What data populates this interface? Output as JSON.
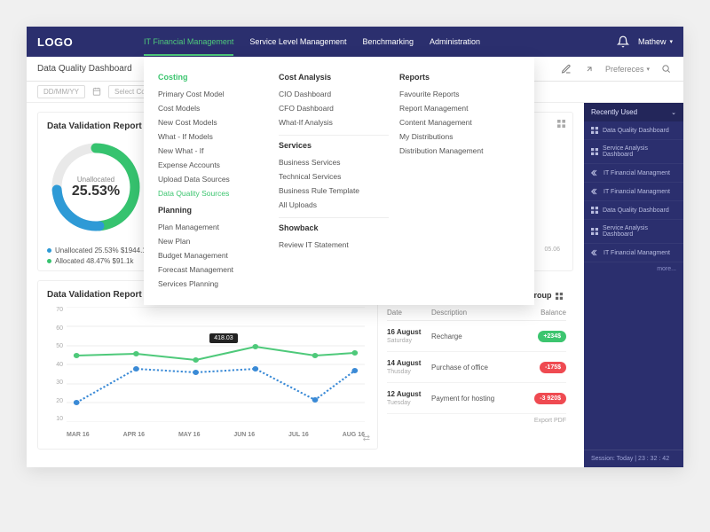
{
  "logo": "LOGO",
  "nav": [
    "IT Financial Management",
    "Service Level Management",
    "Benchmarking",
    "Administration"
  ],
  "user": "Mathew",
  "preferences": "Prefereces",
  "page_title": "Data Quality Dashboard",
  "date_placeholder": "DD/MM/YY",
  "cost_model_placeholder": "Select Cost Model",
  "card1_title": "Data Validation Report Overall",
  "donut": {
    "label": "Unallocated",
    "value": "25.53%"
  },
  "legend": {
    "unalloc": "Unallocated 25.53% $1944.1k",
    "alloc": "Allocated 48.47% $91.1k"
  },
  "axis_last": "05.06",
  "card2_title": "Data Validation Report - Expense",
  "tooltip": "418.03",
  "y_ticks": [
    "70",
    "60",
    "50",
    "40",
    "30",
    "20",
    "10"
  ],
  "x_ticks": [
    "MAR 16",
    "APR 16",
    "MAY 16",
    "JUN 16",
    "JUL 16",
    "AUG 16"
  ],
  "right_title": "Group",
  "tx_head": [
    "Date",
    "Description",
    "Balance"
  ],
  "tx": [
    {
      "d": "16 August",
      "dow": "Saturday",
      "desc": "Recharge",
      "bal": "+234$",
      "cls": "green"
    },
    {
      "d": "14 August",
      "dow": "Thusday",
      "desc": "Purchase of office",
      "bal": "-175$",
      "cls": "red"
    },
    {
      "d": "12 August",
      "dow": "Tuesday",
      "desc": "Payment for hosting",
      "bal": "-3 920$",
      "cls": "red"
    }
  ],
  "export": "Export PDF",
  "recent_title": "Recently Used",
  "recent": [
    {
      "icon": "grid",
      "t": "Data Quality Dashboard"
    },
    {
      "icon": "grid",
      "t": "Service Analysis Dashboard"
    },
    {
      "icon": "back",
      "t": "IT Financial Managment"
    },
    {
      "icon": "back",
      "t": "IT Financial Managment"
    },
    {
      "icon": "grid",
      "t": "Data Quality Dashboard"
    },
    {
      "icon": "grid",
      "t": "Service Analysis Dashboard"
    },
    {
      "icon": "back",
      "t": "IT Financial Managment"
    }
  ],
  "more": "more...",
  "session": "Session:  Today | 23 : 32 : 42",
  "mega": {
    "col1": {
      "h1": "Costing",
      "g1": [
        "Primary Cost Model",
        "Cost Models",
        "New Cost Models",
        "What - If Models",
        "New What - If",
        "Expense Accounts",
        "Upload Data Sources"
      ],
      "g1_green": "Data Quality Sources",
      "h2": "Planning",
      "g2": [
        "Plan Management",
        "New Plan",
        "Budget Management",
        "Forecast Management",
        "Services Planning"
      ]
    },
    "col2": {
      "h1": "Cost Analysis",
      "g1": [
        "CIO Dashboard",
        "CFO Dashboard",
        "What-If Analysis"
      ],
      "h2": "Services",
      "g2": [
        "Business Services",
        "Technical Services",
        "Business Rule Template",
        "All Uploads"
      ],
      "h3": "Showback",
      "g3": [
        "Review IT Statement"
      ]
    },
    "col3": {
      "h1": "Reports",
      "g1": [
        "Favourite Reports",
        "Report Management",
        "Content Management",
        "My Distributions",
        "Distribution Management"
      ]
    }
  },
  "chart_data": [
    {
      "type": "pie",
      "title": "Data Validation Report Overall",
      "series": [
        {
          "name": "Unallocated",
          "value": 25.53,
          "amount": "$1944.1k"
        },
        {
          "name": "Allocated",
          "value": 48.47,
          "amount": "$91.1k"
        }
      ]
    },
    {
      "type": "line",
      "title": "Data Validation Report - Expense",
      "categories": [
        "MAR 16",
        "APR 16",
        "MAY 16",
        "JUN 16",
        "JUL 16",
        "AUG 16"
      ],
      "ylim": [
        0,
        70
      ],
      "series": [
        {
          "name": "green",
          "values": [
            40,
            41,
            38,
            45,
            40,
            42
          ]
        },
        {
          "name": "blue",
          "values": [
            12,
            30,
            28,
            30,
            14,
            30
          ]
        }
      ],
      "annotation": {
        "x": "JUN 16",
        "value": 418.03
      }
    }
  ]
}
